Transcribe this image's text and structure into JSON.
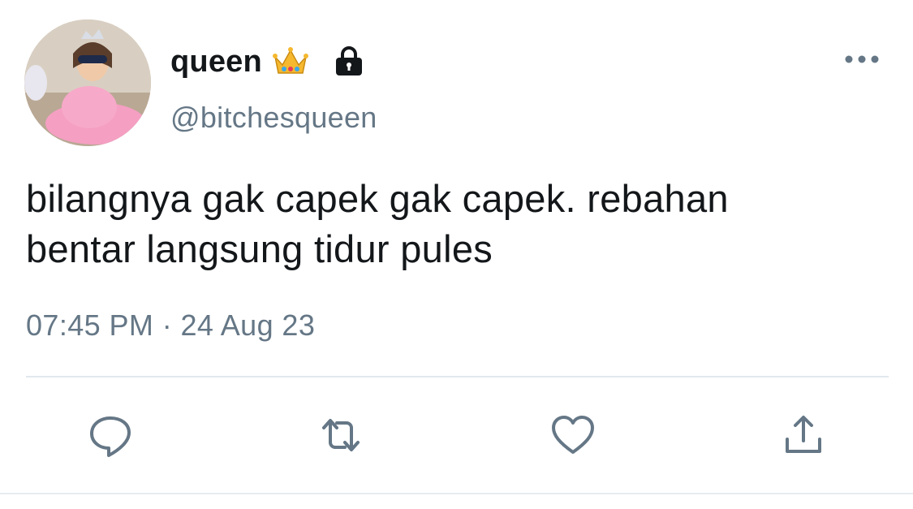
{
  "tweet": {
    "display_name": "queen",
    "handle": "@bitchesqueen",
    "text_line1": "bilangnya gak capek gak capek. rebahan",
    "text_line2": "bentar langsung tidur pules",
    "time": "07:45 PM",
    "separator": "·",
    "date": "24 Aug 23",
    "protected": true,
    "badge_icon": "crown-icon"
  },
  "actions": {
    "reply_icon": "reply-icon",
    "retweet_icon": "retweet-icon",
    "like_icon": "heart-icon",
    "share_icon": "share-icon",
    "more_icon": "more-dots-icon"
  },
  "colors": {
    "text": "#14171a",
    "secondary": "#657786",
    "divider": "#e1e8ed",
    "icon": "#657786"
  }
}
